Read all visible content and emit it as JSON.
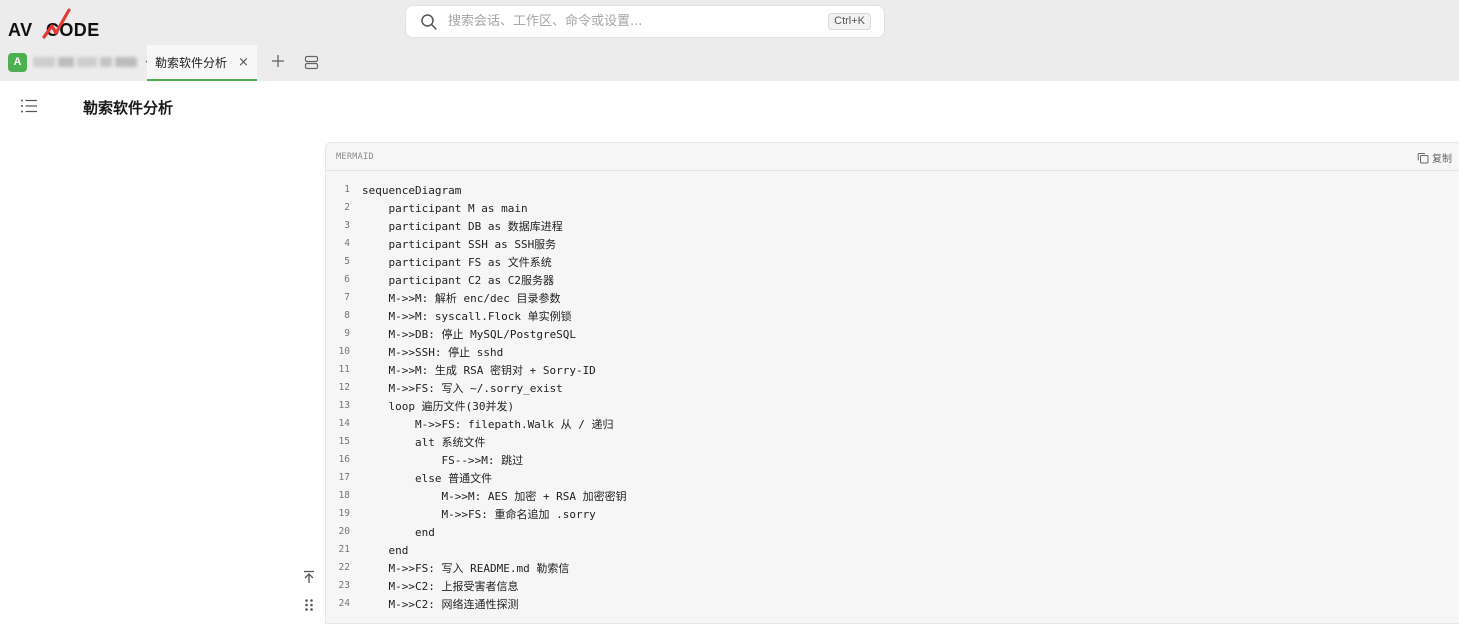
{
  "app": {
    "logo_text": "AVLCODE"
  },
  "search": {
    "placeholder": "搜索会话、工作区、命令或设置...",
    "shortcut": "Ctrl+K"
  },
  "workspace": {
    "avatar_letter": "A"
  },
  "tabs": [
    {
      "label": "勒索软件分析",
      "close": "×"
    }
  ],
  "page": {
    "title": "勒索软件分析"
  },
  "code_block": {
    "language": "MERMAID",
    "copy_label": "复制",
    "lines": [
      {
        "n": "1",
        "text": "sequenceDiagram"
      },
      {
        "n": "2",
        "text": "    participant M as main"
      },
      {
        "n": "3",
        "text": "    participant DB as 数据库进程"
      },
      {
        "n": "4",
        "text": "    participant SSH as SSH服务"
      },
      {
        "n": "5",
        "text": "    participant FS as 文件系统"
      },
      {
        "n": "6",
        "text": "    participant C2 as C2服务器"
      },
      {
        "n": "7",
        "text": "    M->>M: 解析 enc/dec 目录参数"
      },
      {
        "n": "8",
        "text": "    M->>M: syscall.Flock 单实例锁"
      },
      {
        "n": "9",
        "text": "    M->>DB: 停止 MySQL/PostgreSQL"
      },
      {
        "n": "10",
        "text": "    M->>SSH: 停止 sshd"
      },
      {
        "n": "11",
        "text": "    M->>M: 生成 RSA 密钥对 + Sorry-ID"
      },
      {
        "n": "12",
        "text": "    M->>FS: 写入 ~/.sorry_exist"
      },
      {
        "n": "13",
        "text": "    loop 遍历文件(30并发)"
      },
      {
        "n": "14",
        "text": "        M->>FS: filepath.Walk 从 / 递归"
      },
      {
        "n": "15",
        "text": "        alt 系统文件"
      },
      {
        "n": "16",
        "text": "            FS-->>M: 跳过"
      },
      {
        "n": "17",
        "text": "        else 普通文件"
      },
      {
        "n": "18",
        "text": "            M->>M: AES 加密 + RSA 加密密钥"
      },
      {
        "n": "19",
        "text": "            M->>FS: 重命名追加 .sorry"
      },
      {
        "n": "20",
        "text": "        end"
      },
      {
        "n": "21",
        "text": "    end"
      },
      {
        "n": "22",
        "text": "    M->>FS: 写入 README.md 勒索信"
      },
      {
        "n": "23",
        "text": "    M->>C2: 上报受害者信息"
      },
      {
        "n": "24",
        "text": "    M->>C2: 网络连通性探测"
      }
    ]
  },
  "colors": {
    "accent": "#4caf50",
    "logo_mark": "#e53935",
    "topbar_bg": "#ececec",
    "code_bg": "#f6f6f6"
  },
  "icons": {
    "search": "search-icon",
    "chevron": "chevron-down-icon",
    "add_tab": "plus-icon",
    "layout": "split-layout-icon",
    "outline": "outline-list-icon",
    "copy": "copy-icon",
    "scroll_top": "arrow-to-top-icon",
    "drag": "drag-handle-icon"
  }
}
